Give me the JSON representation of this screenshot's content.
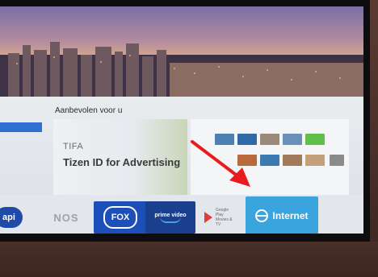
{
  "panel": {
    "title": "Aanbevolen voor u"
  },
  "featured_card": {
    "brand": "TIFA",
    "headline": "Tizen ID for Advertising"
  },
  "apps": [
    {
      "label": "api"
    },
    {
      "label": "NOS"
    },
    {
      "label": "FOX"
    },
    {
      "label": "prime video"
    },
    {
      "label": "Google Play Movies & TV"
    },
    {
      "label": "Internet"
    }
  ],
  "selected_app": "Internet",
  "colors": {
    "accent_blue": "#3aa4df",
    "annotation_arrow": "#e81c1c"
  }
}
